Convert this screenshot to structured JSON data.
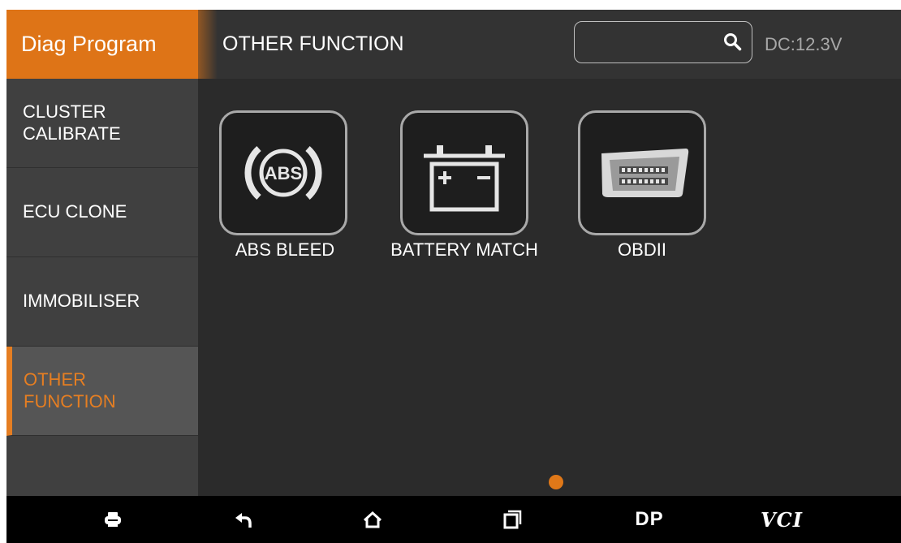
{
  "header": {
    "brand": "Diag Program",
    "title": "OTHER FUNCTION",
    "search": {
      "value": "",
      "placeholder": ""
    },
    "voltage": "DC:12.3V"
  },
  "sidebar": {
    "items": [
      {
        "label": "CLUSTER\nCALIBRATE",
        "active": false
      },
      {
        "label": "ECU CLONE",
        "active": false
      },
      {
        "label": "IMMOBILISER",
        "active": false
      },
      {
        "label": "OTHER\nFUNCTION",
        "active": true
      }
    ]
  },
  "functions": [
    {
      "label": "ABS BLEED",
      "icon": "abs-icon"
    },
    {
      "label": "BATTERY MATCH",
      "icon": "battery-icon"
    },
    {
      "label": "OBDII",
      "icon": "obd-connector-icon"
    }
  ],
  "pagination": {
    "current_page": 1,
    "total_pages": 1
  },
  "navbar": {
    "items": [
      {
        "icon": "printer-icon"
      },
      {
        "icon": "back-icon"
      },
      {
        "icon": "home-icon"
      },
      {
        "icon": "recent-apps-icon"
      },
      {
        "label": "DP"
      },
      {
        "label": "VCI"
      }
    ]
  },
  "colors": {
    "accent": "#e57e22",
    "brand_background": "#de7417",
    "header_background": "#333333",
    "sidebar_background": "#404040",
    "content_background": "#2b2b2b",
    "navbar_background": "#000000"
  }
}
